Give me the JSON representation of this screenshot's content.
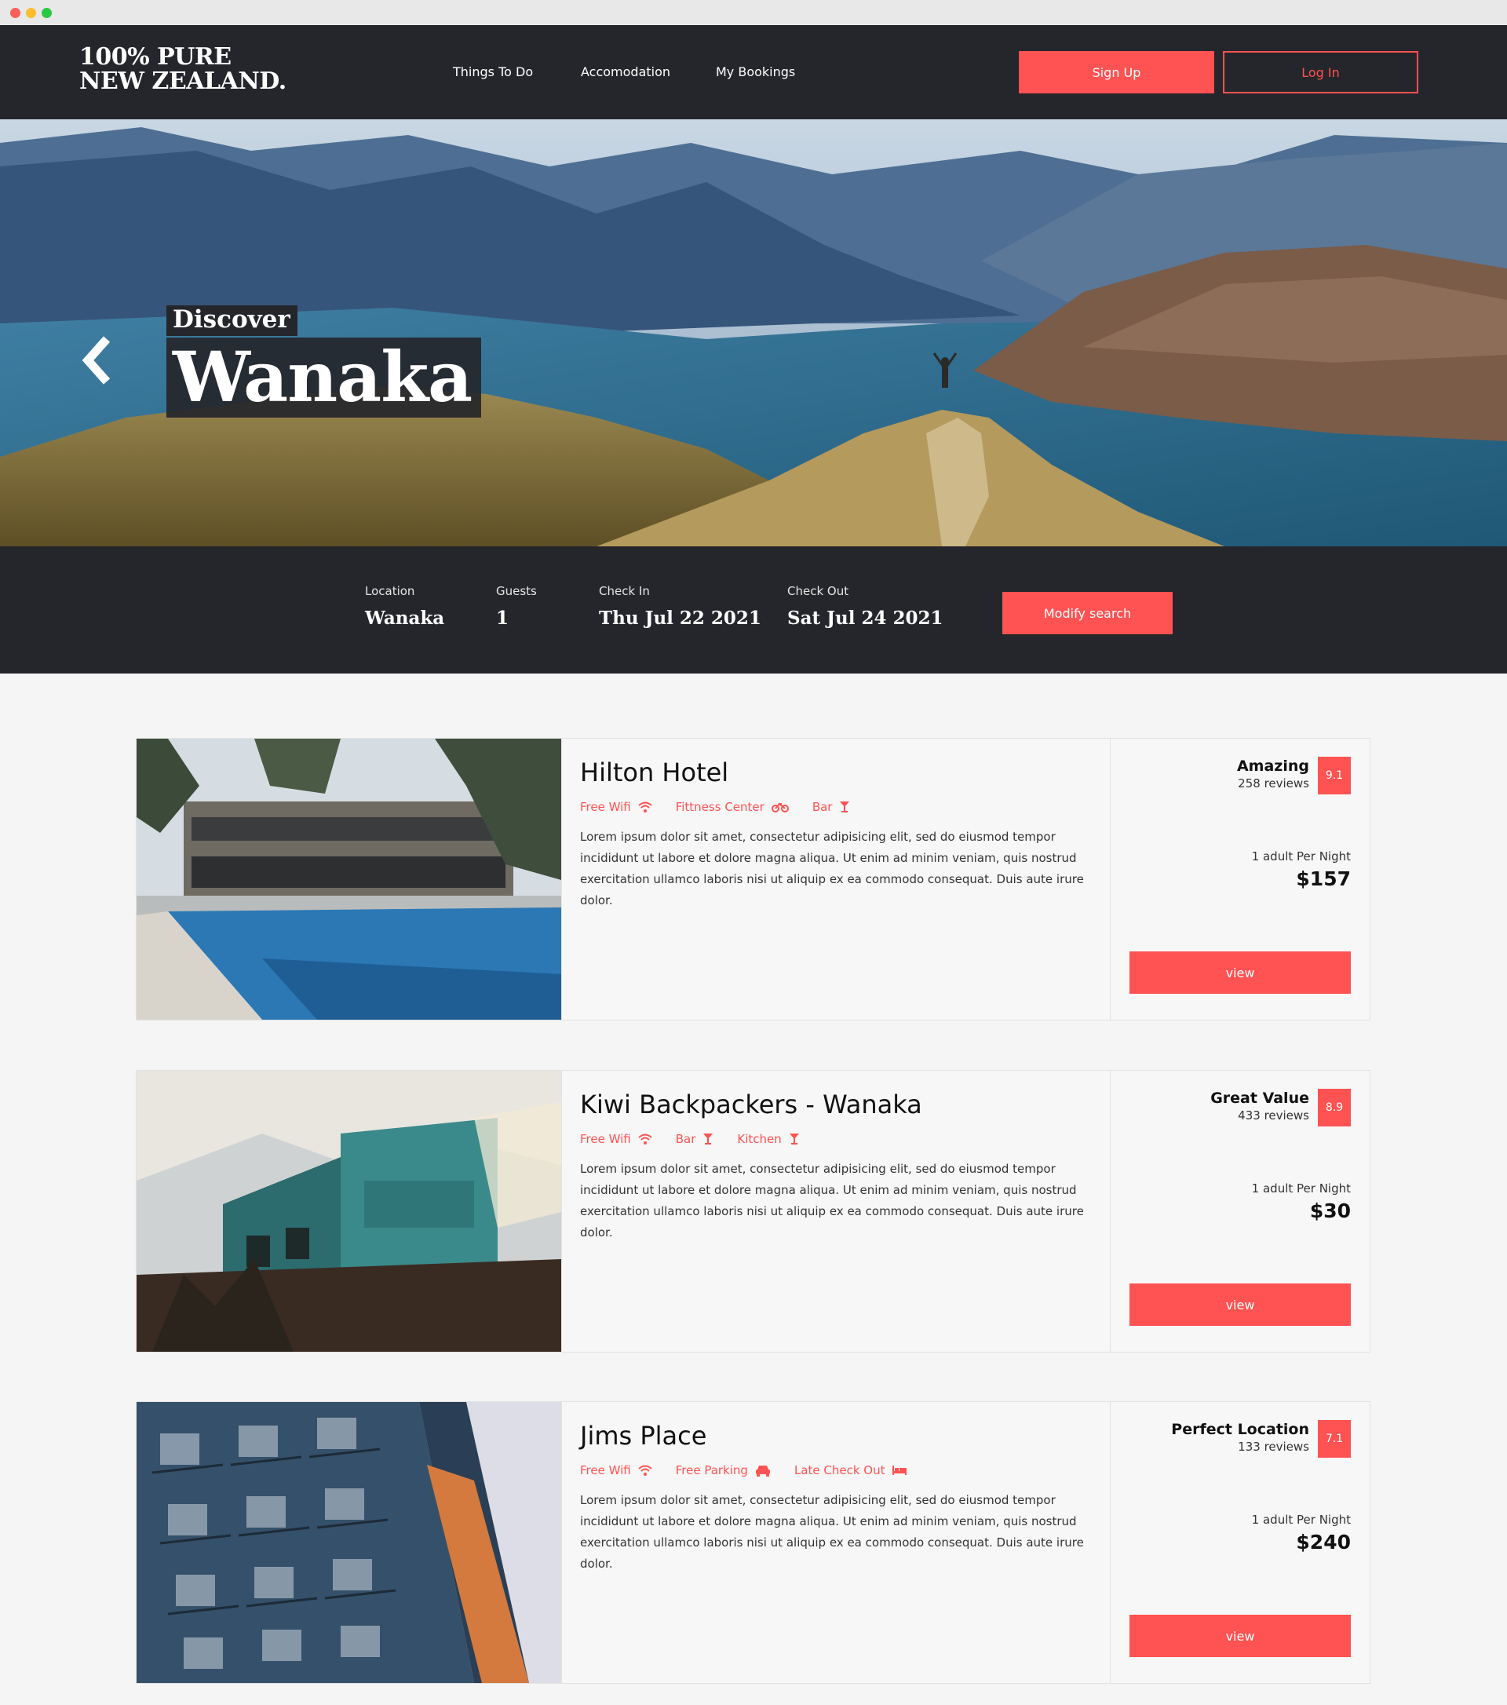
{
  "brand": {
    "line1": "100% PURE",
    "line2": "NEW ZEALAND."
  },
  "nav": [
    {
      "label": "Things To Do"
    },
    {
      "label": "Accomodation"
    },
    {
      "label": "My Bookings"
    }
  ],
  "auth": {
    "signup_label": "Sign Up",
    "login_label": "Log In"
  },
  "hero": {
    "kicker": "Discover",
    "title": "Wanaka",
    "prev_icon": "chevron-left-icon"
  },
  "search": {
    "location": {
      "label": "Location",
      "value": "Wanaka"
    },
    "guests": {
      "label": "Guests",
      "value": "1"
    },
    "checkin": {
      "label": "Check In",
      "value": "Thu Jul 22 2021"
    },
    "checkout": {
      "label": "Check Out",
      "value": "Sat Jul 24 2021"
    },
    "modify_label": "Modify search"
  },
  "colors": {
    "accent": "#ff5252",
    "dark": "#25262b",
    "page": "#f5f5f5"
  },
  "listings": [
    {
      "title": "Hilton Hotel",
      "amenities": [
        {
          "label": "Free Wifi",
          "icon": "wifi-icon"
        },
        {
          "label": "Fittness Center",
          "icon": "bicycle-icon"
        },
        {
          "label": "Bar",
          "icon": "cocktail-icon"
        }
      ],
      "description": "Lorem ipsum dolor sit amet, consectetur adipisicing elit, sed do eiusmod tempor incididunt ut labore et dolore magna aliqua. Ut enim ad minim veniam, quis nostrud exercitation ullamco laboris nisi ut aliquip ex ea commodo consequat. Duis aute irure dolor.",
      "rating_label": "Amazing",
      "reviews": "258 reviews",
      "score": "9.1",
      "per_night": "1 adult Per Night",
      "price": "$157",
      "view_label": "view"
    },
    {
      "title": "Kiwi Backpackers - Wanaka",
      "amenities": [
        {
          "label": "Free Wifi",
          "icon": "wifi-icon"
        },
        {
          "label": "Bar",
          "icon": "cocktail-icon"
        },
        {
          "label": "Kitchen",
          "icon": "cocktail-icon"
        }
      ],
      "description": "Lorem ipsum dolor sit amet, consectetur adipisicing elit, sed do eiusmod tempor incididunt ut labore et dolore magna aliqua. Ut enim ad minim veniam, quis nostrud exercitation ullamco laboris nisi ut aliquip ex ea commodo consequat. Duis aute irure dolor.",
      "rating_label": "Great Value",
      "reviews": "433 reviews",
      "score": "8.9",
      "per_night": "1 adult Per Night",
      "price": "$30",
      "view_label": "view"
    },
    {
      "title": "Jims Place",
      "amenities": [
        {
          "label": "Free Wifi",
          "icon": "wifi-icon"
        },
        {
          "label": "Free Parking",
          "icon": "car-icon"
        },
        {
          "label": "Late Check Out",
          "icon": "bed-icon"
        }
      ],
      "description": "Lorem ipsum dolor sit amet, consectetur adipisicing elit, sed do eiusmod tempor incididunt ut labore et dolore magna aliqua. Ut enim ad minim veniam, quis nostrud exercitation ullamco laboris nisi ut aliquip ex ea commodo consequat. Duis aute irure dolor.",
      "rating_label": "Perfect Location",
      "reviews": "133 reviews",
      "score": "7.1",
      "per_night": "1 adult Per Night",
      "price": "$240",
      "view_label": "view"
    }
  ]
}
